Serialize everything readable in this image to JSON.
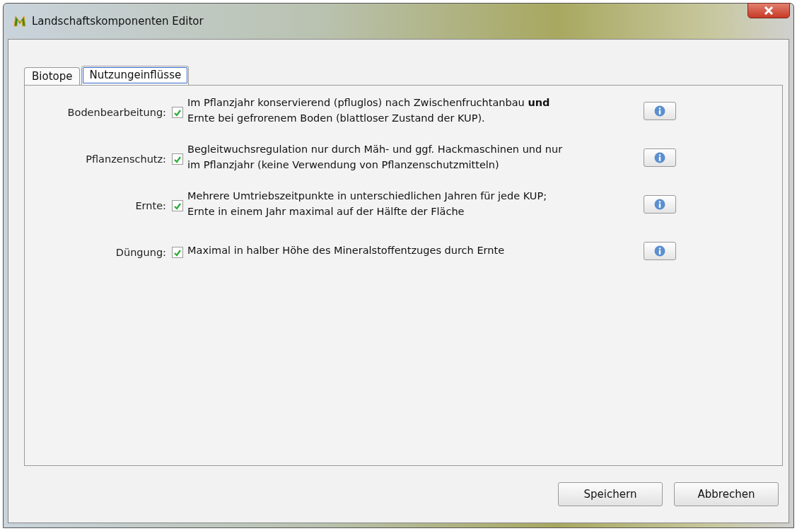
{
  "window": {
    "title": "Landschaftskomponenten Editor"
  },
  "tabs": [
    {
      "label": "Biotope",
      "selected": false
    },
    {
      "label": "Nutzungeinflüsse",
      "selected": true
    }
  ],
  "rows": [
    {
      "label": "Bodenbearbeitung:",
      "checked": true,
      "text": "Im Pflanzjahr konservierend (pfluglos) nach Zwischenfruchtanbau **und** Ernte bei gefrorenem Boden (blattloser Zustand der KUP)."
    },
    {
      "label": "Pflanzenschutz:",
      "checked": true,
      "text": "Begleitwuchsregulation nur durch Mäh- und ggf. Hackmaschinen und nur im Pflanzjahr (keine Verwendung von Pflanzenschutzmitteln)"
    },
    {
      "label": "Ernte:",
      "checked": true,
      "text": "Mehrere Umtriebszeitpunkte in unterschiedlichen Jahren für jede KUP; Ernte in einem Jahr maximal auf der Hälfte der Fläche"
    },
    {
      "label": "Düngung:",
      "checked": true,
      "text": "Maximal in halber Höhe des Mineralstoffentzuges durch Ernte"
    }
  ],
  "buttons": [
    "Speichern",
    "Abbrechen"
  ]
}
